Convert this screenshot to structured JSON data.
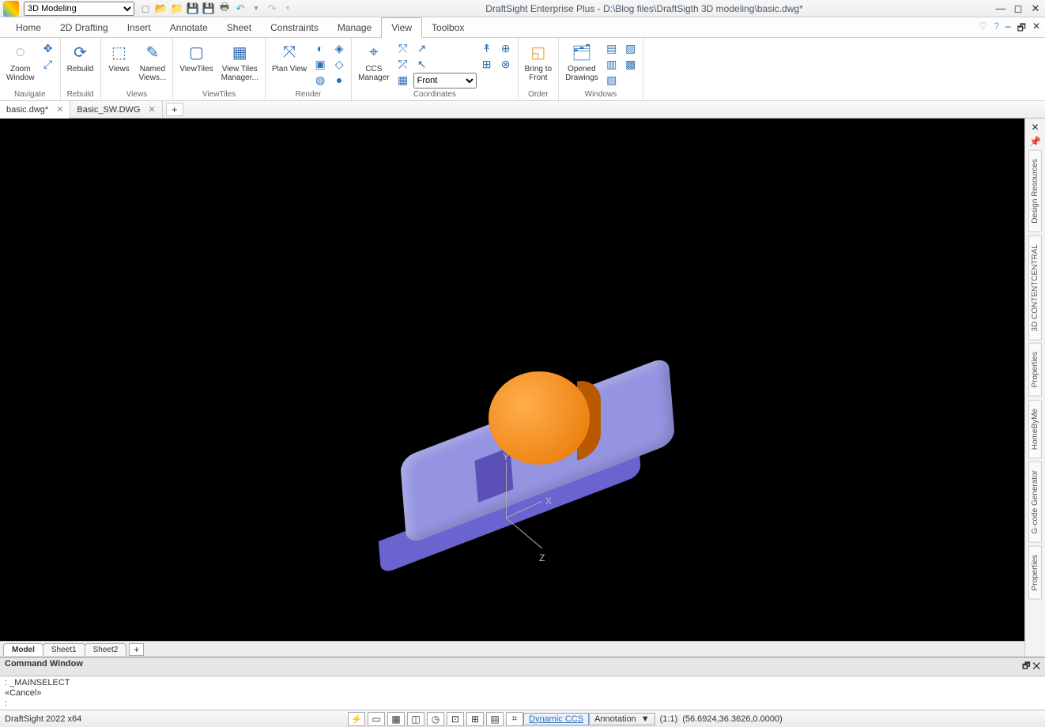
{
  "workspace_dropdown": "3D Modeling",
  "window_title": "DraftSight Enterprise Plus - D:\\Blog files\\DraftSigth 3D modeling\\basic.dwg*",
  "menu_tabs": [
    "Home",
    "2D Drafting",
    "Insert",
    "Annotate",
    "Sheet",
    "Constraints",
    "Manage",
    "View",
    "Toolbox"
  ],
  "active_menu_tab": "View",
  "ribbon": {
    "navigate": {
      "label": "Navigate",
      "zoom": "Zoom\nWindow"
    },
    "rebuild": {
      "label": "Rebuild",
      "btn": "Rebuild"
    },
    "views": {
      "label": "Views",
      "views_btn": "Views",
      "named_views": "Named\nViews..."
    },
    "viewtiles": {
      "label": "ViewTiles",
      "viewtiles": "ViewTiles",
      "vt_manager": "View Tiles\nManager..."
    },
    "render": {
      "label": "Render",
      "plan": "Plan View"
    },
    "coordinates": {
      "label": "Coordinates",
      "ccs_mgr": "CCS\nManager",
      "orient_sel": "Front"
    },
    "order": {
      "label": "Order",
      "bring": "Bring to\nFront"
    },
    "windows": {
      "label": "Windows",
      "opened": "Opened\nDrawings"
    }
  },
  "doc_tabs": [
    {
      "name": "basic.dwg*",
      "active": true
    },
    {
      "name": "Basic_SW.DWG",
      "active": false
    }
  ],
  "right_panels": [
    "Design Resources",
    "3D CONTENTCENTRAL",
    "Properties",
    "HomeByMe",
    "G-code Generator",
    "Properties"
  ],
  "sheet_tabs": [
    "Model",
    "Sheet1",
    "Sheet2"
  ],
  "active_sheet": "Model",
  "command_window": {
    "title": "Command Window",
    "lines": [
      ": _MAINSELECT",
      "«Cancel»",
      ":"
    ]
  },
  "status": {
    "app_version": "DraftSight 2022 x64",
    "dyn_ccs": "Dynamic CCS",
    "annotation": "Annotation",
    "ratio": "(1:1)",
    "coords": "(56.6924,36.3626,0.0000)"
  },
  "axes": {
    "x": "X",
    "y": "Y",
    "z": "Z"
  }
}
